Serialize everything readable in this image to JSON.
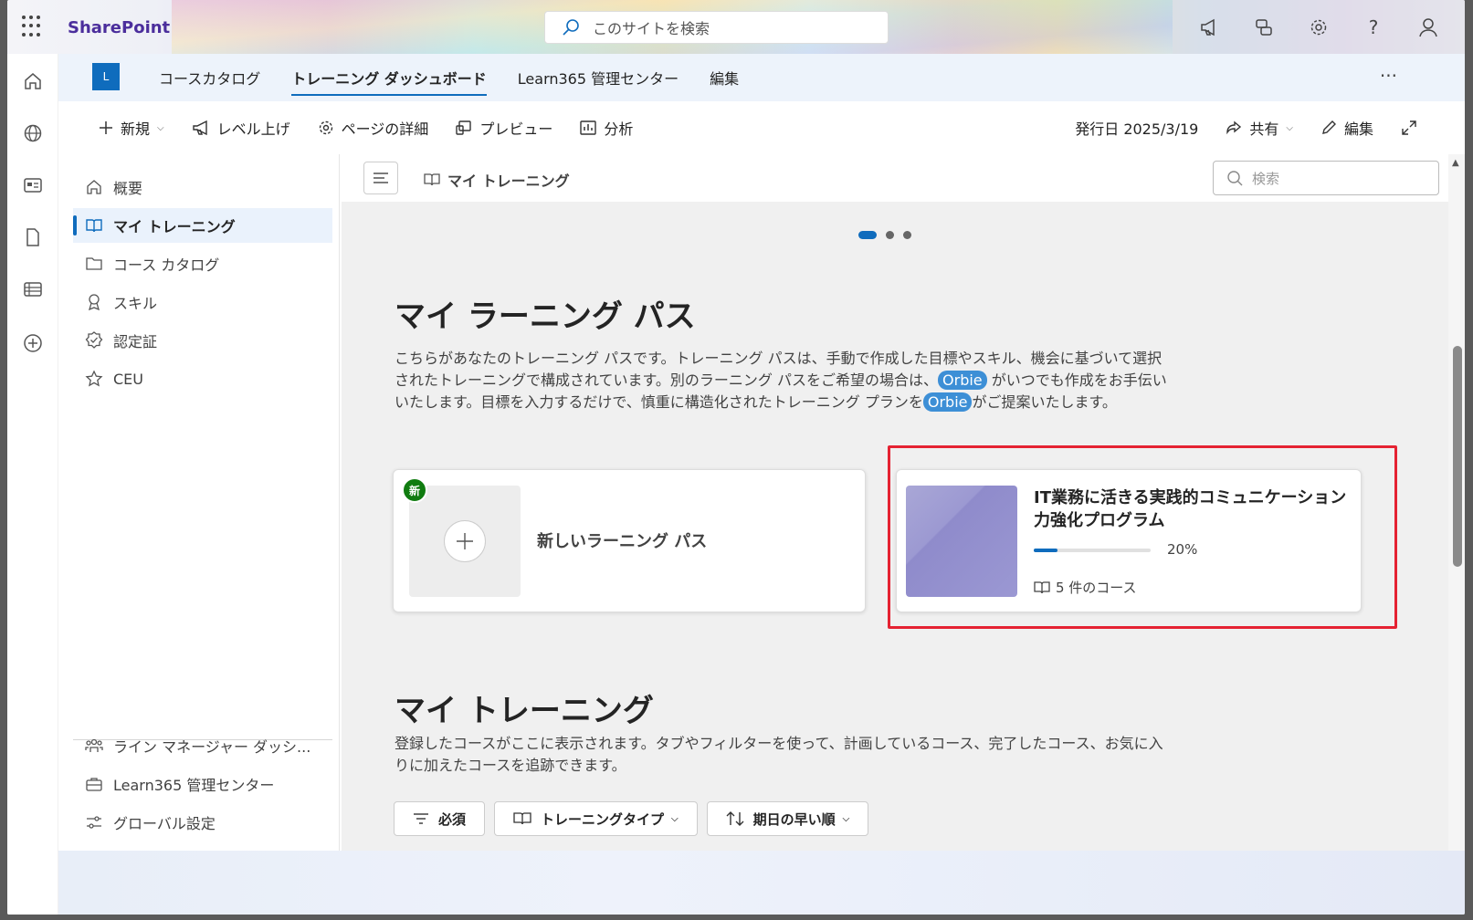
{
  "suite": {
    "brand": "SharePoint",
    "search_placeholder": "このサイトを検索"
  },
  "site": {
    "logo_letter": "L",
    "nav": [
      "コースカタログ",
      "トレーニング ダッシュボード",
      "Learn365 管理センター",
      "編集"
    ],
    "more": "···"
  },
  "command": {
    "new": "新規",
    "level_up": "レベル上げ",
    "page_details": "ページの詳細",
    "preview": "プレビュー",
    "analytics": "分析",
    "published": "発行日 2025/3/19",
    "share": "共有",
    "edit": "編集"
  },
  "leftnav": {
    "items": [
      "概要",
      "マイ トレーニング",
      "コース カタログ",
      "スキル",
      "認定証",
      "CEU"
    ],
    "bottom": [
      "ライン マネージャー ダッシ...",
      "Learn365 管理センター",
      "グローバル設定"
    ]
  },
  "main": {
    "breadcrumb": "マイ トレーニング",
    "search_placeholder": "検索",
    "lp_title": "マイ ラーニング パス",
    "lp_desc_1": "こちらがあなたのトレーニング パスです。トレーニング パスは、手動で作成した目標やスキル、機会に基づいて選択されたトレーニングで構成されています。別のラーニング パスをご希望の場合は、",
    "orbie": "Orbie",
    "lp_desc_2": " がいつでも作成をお手伝いいたします。目標を入力するだけで、慎重に構造化されたトレーニング プランを",
    "lp_desc_3": "がご提案いたします。",
    "new_badge": "新",
    "new_path": "新しいラーニング パス",
    "program_title": "IT業務に活きる実践的コミュニケーション力強化プログラム",
    "program_progress": 0.2,
    "program_pct": "20%",
    "program_courses": "5 件のコース",
    "mt_title": "マイ トレーニング",
    "mt_desc": "登録したコースがここに表示されます。タブやフィルターを使って、計画しているコース、完了したコース、お気に入りに加えたコースを追跡できます。",
    "filter_required": "必須",
    "filter_type": "トレーニングタイプ",
    "filter_sort": "期日の早い順"
  },
  "colors": {
    "accent": "#0f6cbd",
    "brand": "#4b2e9c",
    "highlight": "#e52232",
    "badge": "#107c10"
  }
}
